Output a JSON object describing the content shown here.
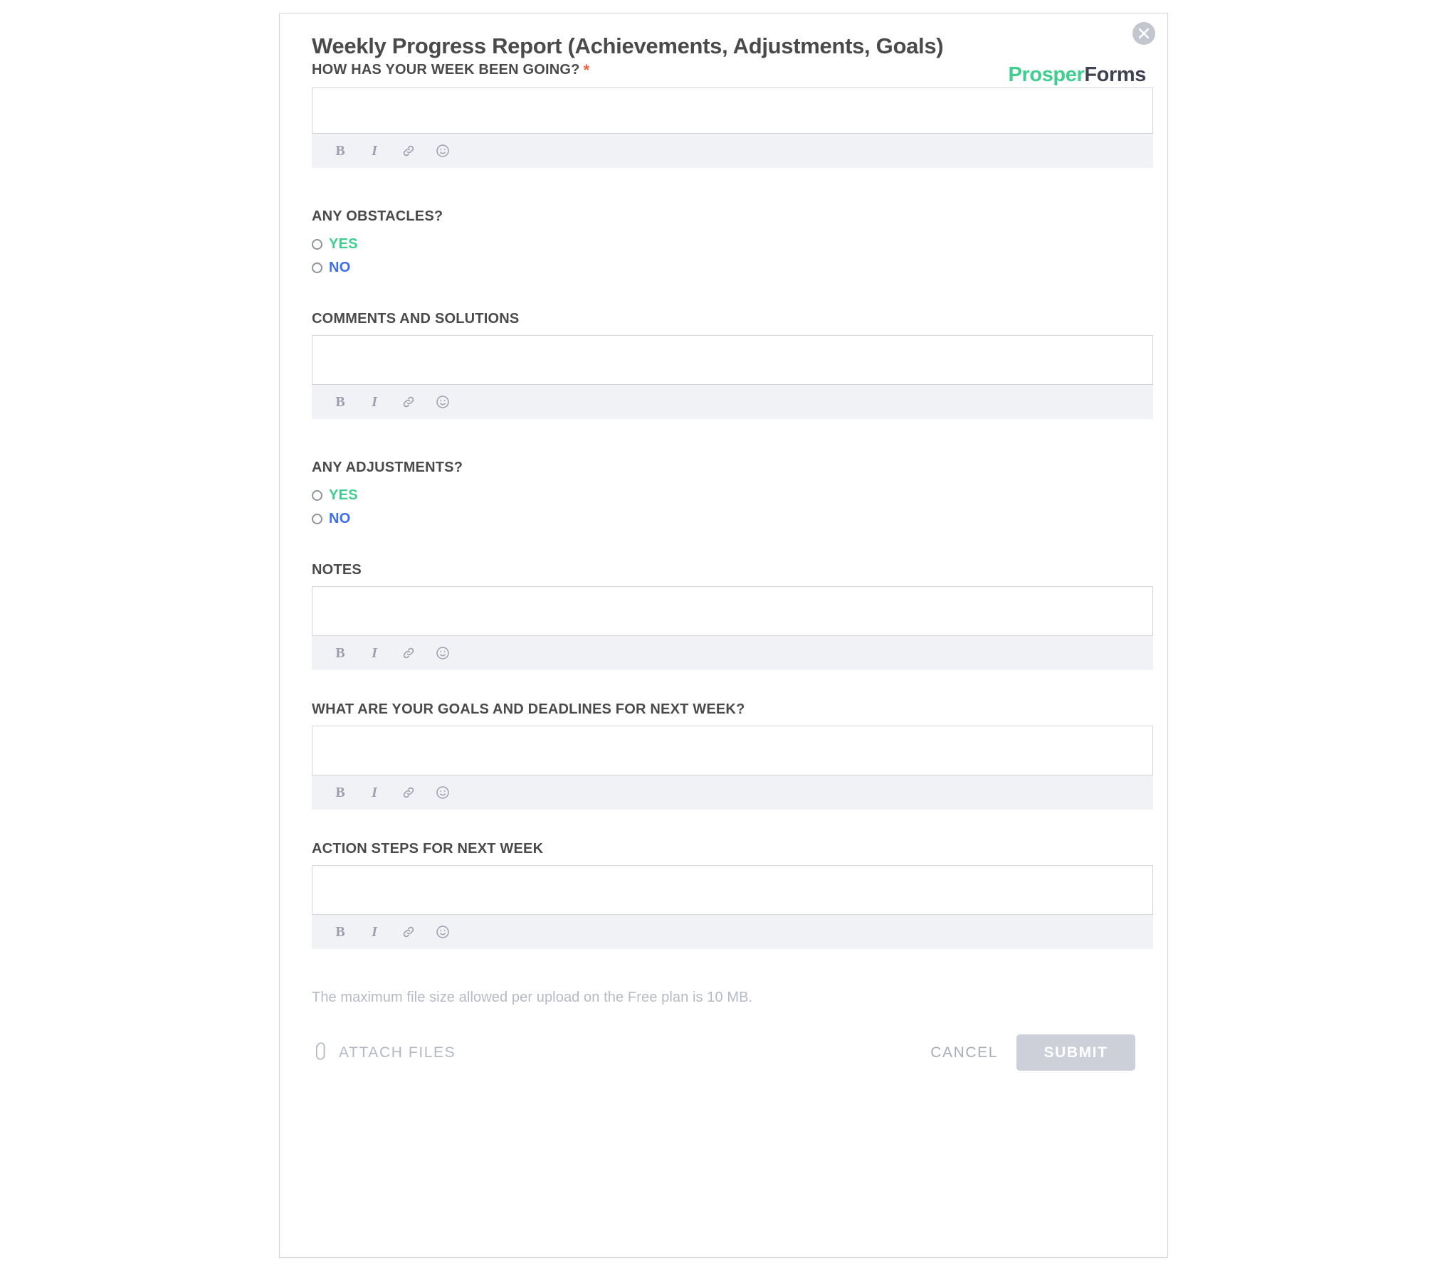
{
  "card": {
    "title": "Weekly Progress Report (Achievements, Adjustments, Goals)",
    "close_icon": "close-icon"
  },
  "brand": {
    "part1": "Prosper",
    "part2": "Forms",
    "color1": "#3ecf8e",
    "color2": "#3f4250"
  },
  "editor_toolbar": {
    "bold": "B",
    "italic": "I",
    "link_icon": "link-icon",
    "emoji_icon": "emoji-icon"
  },
  "fields": [
    {
      "label": "HOW HAS YOUR WEEK BEEN GOING?",
      "required": true,
      "required_marker": "*",
      "type": "richtext",
      "value": ""
    },
    {
      "label": "ANY OBSTACLES?",
      "required": false,
      "type": "radio",
      "options": [
        {
          "label": "YES",
          "selected": false,
          "color": "#3ecf8e"
        },
        {
          "label": "NO",
          "selected": false,
          "color": "#3d6ef0"
        }
      ]
    },
    {
      "label": "COMMENTS AND SOLUTIONS",
      "required": false,
      "type": "richtext",
      "value": ""
    },
    {
      "label": "ANY ADJUSTMENTS?",
      "required": false,
      "type": "radio",
      "options": [
        {
          "label": "YES",
          "selected": false,
          "color": "#3ecf8e"
        },
        {
          "label": "NO",
          "selected": false,
          "color": "#3d6ef0"
        }
      ]
    },
    {
      "label": "NOTES",
      "required": false,
      "type": "richtext",
      "value": ""
    },
    {
      "label": "WHAT ARE YOUR GOALS AND DEADLINES FOR NEXT WEEK?",
      "required": false,
      "type": "richtext",
      "value": ""
    },
    {
      "label": "ACTION STEPS FOR NEXT WEEK",
      "required": false,
      "type": "richtext",
      "value": ""
    }
  ],
  "footer": {
    "note": "The maximum file size allowed per upload on the Free plan is 10 MB.",
    "attach_label": "ATTACH FILES",
    "attach_icon": "paperclip-icon",
    "cancel_label": "CANCEL",
    "submit_label": "SUBMIT",
    "submit_disabled": true,
    "submit_bg": "#cdd0d8"
  }
}
